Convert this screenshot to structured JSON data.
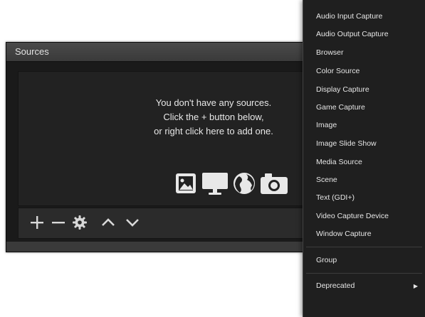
{
  "sources_dock": {
    "title": "Sources",
    "empty_message": [
      "You don't have any sources.",
      "Click the + button below,",
      "or right click here to add one."
    ],
    "placeholder_icons": [
      "image-icon",
      "monitor-icon",
      "globe-icon",
      "camera-icon"
    ],
    "toolbar": [
      {
        "name": "add-source-button",
        "icon": "plus-icon"
      },
      {
        "name": "remove-source-button",
        "icon": "minus-icon"
      },
      {
        "name": "source-properties-button",
        "icon": "gear-icon"
      },
      {
        "name": "move-source-up-button",
        "icon": "chevron-up-icon"
      },
      {
        "name": "move-source-down-button",
        "icon": "chevron-down-icon"
      }
    ]
  },
  "context_menu": {
    "items": [
      "Audio Input Capture",
      "Audio Output Capture",
      "Browser",
      "Color Source",
      "Display Capture",
      "Game Capture",
      "Image",
      "Image Slide Show",
      "Media Source",
      "Scene",
      "Text (GDI+)",
      "Video Capture Device",
      "Window Capture"
    ],
    "group": "Group",
    "deprecated": "Deprecated"
  },
  "colors": {
    "dock_background": "#1a1a1a",
    "menu_background": "#1f1f1f",
    "text": "#e6e6e6"
  }
}
